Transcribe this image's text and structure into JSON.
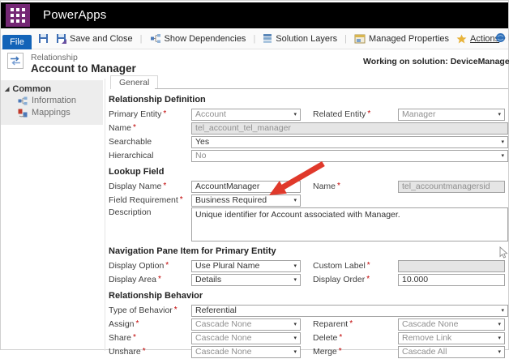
{
  "ui": {
    "req": "*",
    "caret": "▾",
    "expander": "◢",
    "separator": "|"
  },
  "app_header": {
    "title": "PowerApps",
    "brand_color": "#742774"
  },
  "toolbar": {
    "file": "File",
    "save_and_close": "Save and Close",
    "show_dependencies": "Show Dependencies",
    "solution_layers": "Solution Layers",
    "managed_properties": "Managed Properties",
    "actions": "Actions",
    "help": "H"
  },
  "record_header": {
    "type": "Relationship",
    "title": "Account to Manager",
    "working_on": "Working on solution: DeviceManagem"
  },
  "sidebar": {
    "group_label": "Common",
    "items": [
      {
        "label": "Information"
      },
      {
        "label": "Mappings"
      }
    ]
  },
  "tabs": {
    "general": "General"
  },
  "form": {
    "relationship_definition": {
      "title": "Relationship Definition",
      "primary_entity": {
        "label": "Primary Entity",
        "value": "Account"
      },
      "related_entity": {
        "label": "Related Entity",
        "value": "Manager"
      },
      "name": {
        "label": "Name",
        "value": "tel_account_tel_manager"
      },
      "searchable": {
        "label": "Searchable",
        "value": "Yes"
      },
      "hierarchical": {
        "label": "Hierarchical",
        "value": "No"
      }
    },
    "lookup_field": {
      "title": "Lookup Field",
      "display_name": {
        "label": "Display Name",
        "value": "AccountManager"
      },
      "name": {
        "label": "Name",
        "value": "tel_accountmanagersid"
      },
      "field_requirement": {
        "label": "Field Requirement",
        "value": "Business Required"
      },
      "description": {
        "label": "Description",
        "value": "Unique identifier for Account associated with Manager."
      }
    },
    "navigation_pane": {
      "title": "Navigation Pane Item for Primary Entity",
      "display_option": {
        "label": "Display Option",
        "value": "Use Plural Name"
      },
      "custom_label": {
        "label": "Custom Label",
        "value": ""
      },
      "display_area": {
        "label": "Display Area",
        "value": "Details"
      },
      "display_order": {
        "label": "Display Order",
        "value": "10.000"
      }
    },
    "relationship_behavior": {
      "title": "Relationship Behavior",
      "type_of_behavior": {
        "label": "Type of Behavior",
        "value": "Referential"
      },
      "assign": {
        "label": "Assign",
        "value": "Cascade None"
      },
      "reparent": {
        "label": "Reparent",
        "value": "Cascade None"
      },
      "share": {
        "label": "Share",
        "value": "Cascade None"
      },
      "delete": {
        "label": "Delete",
        "value": "Remove Link"
      },
      "unshare": {
        "label": "Unshare",
        "value": "Cascade None"
      },
      "merge": {
        "label": "Merge",
        "value": "Cascade All"
      }
    }
  },
  "annotations": {
    "arrow_color": "#e0392b"
  }
}
